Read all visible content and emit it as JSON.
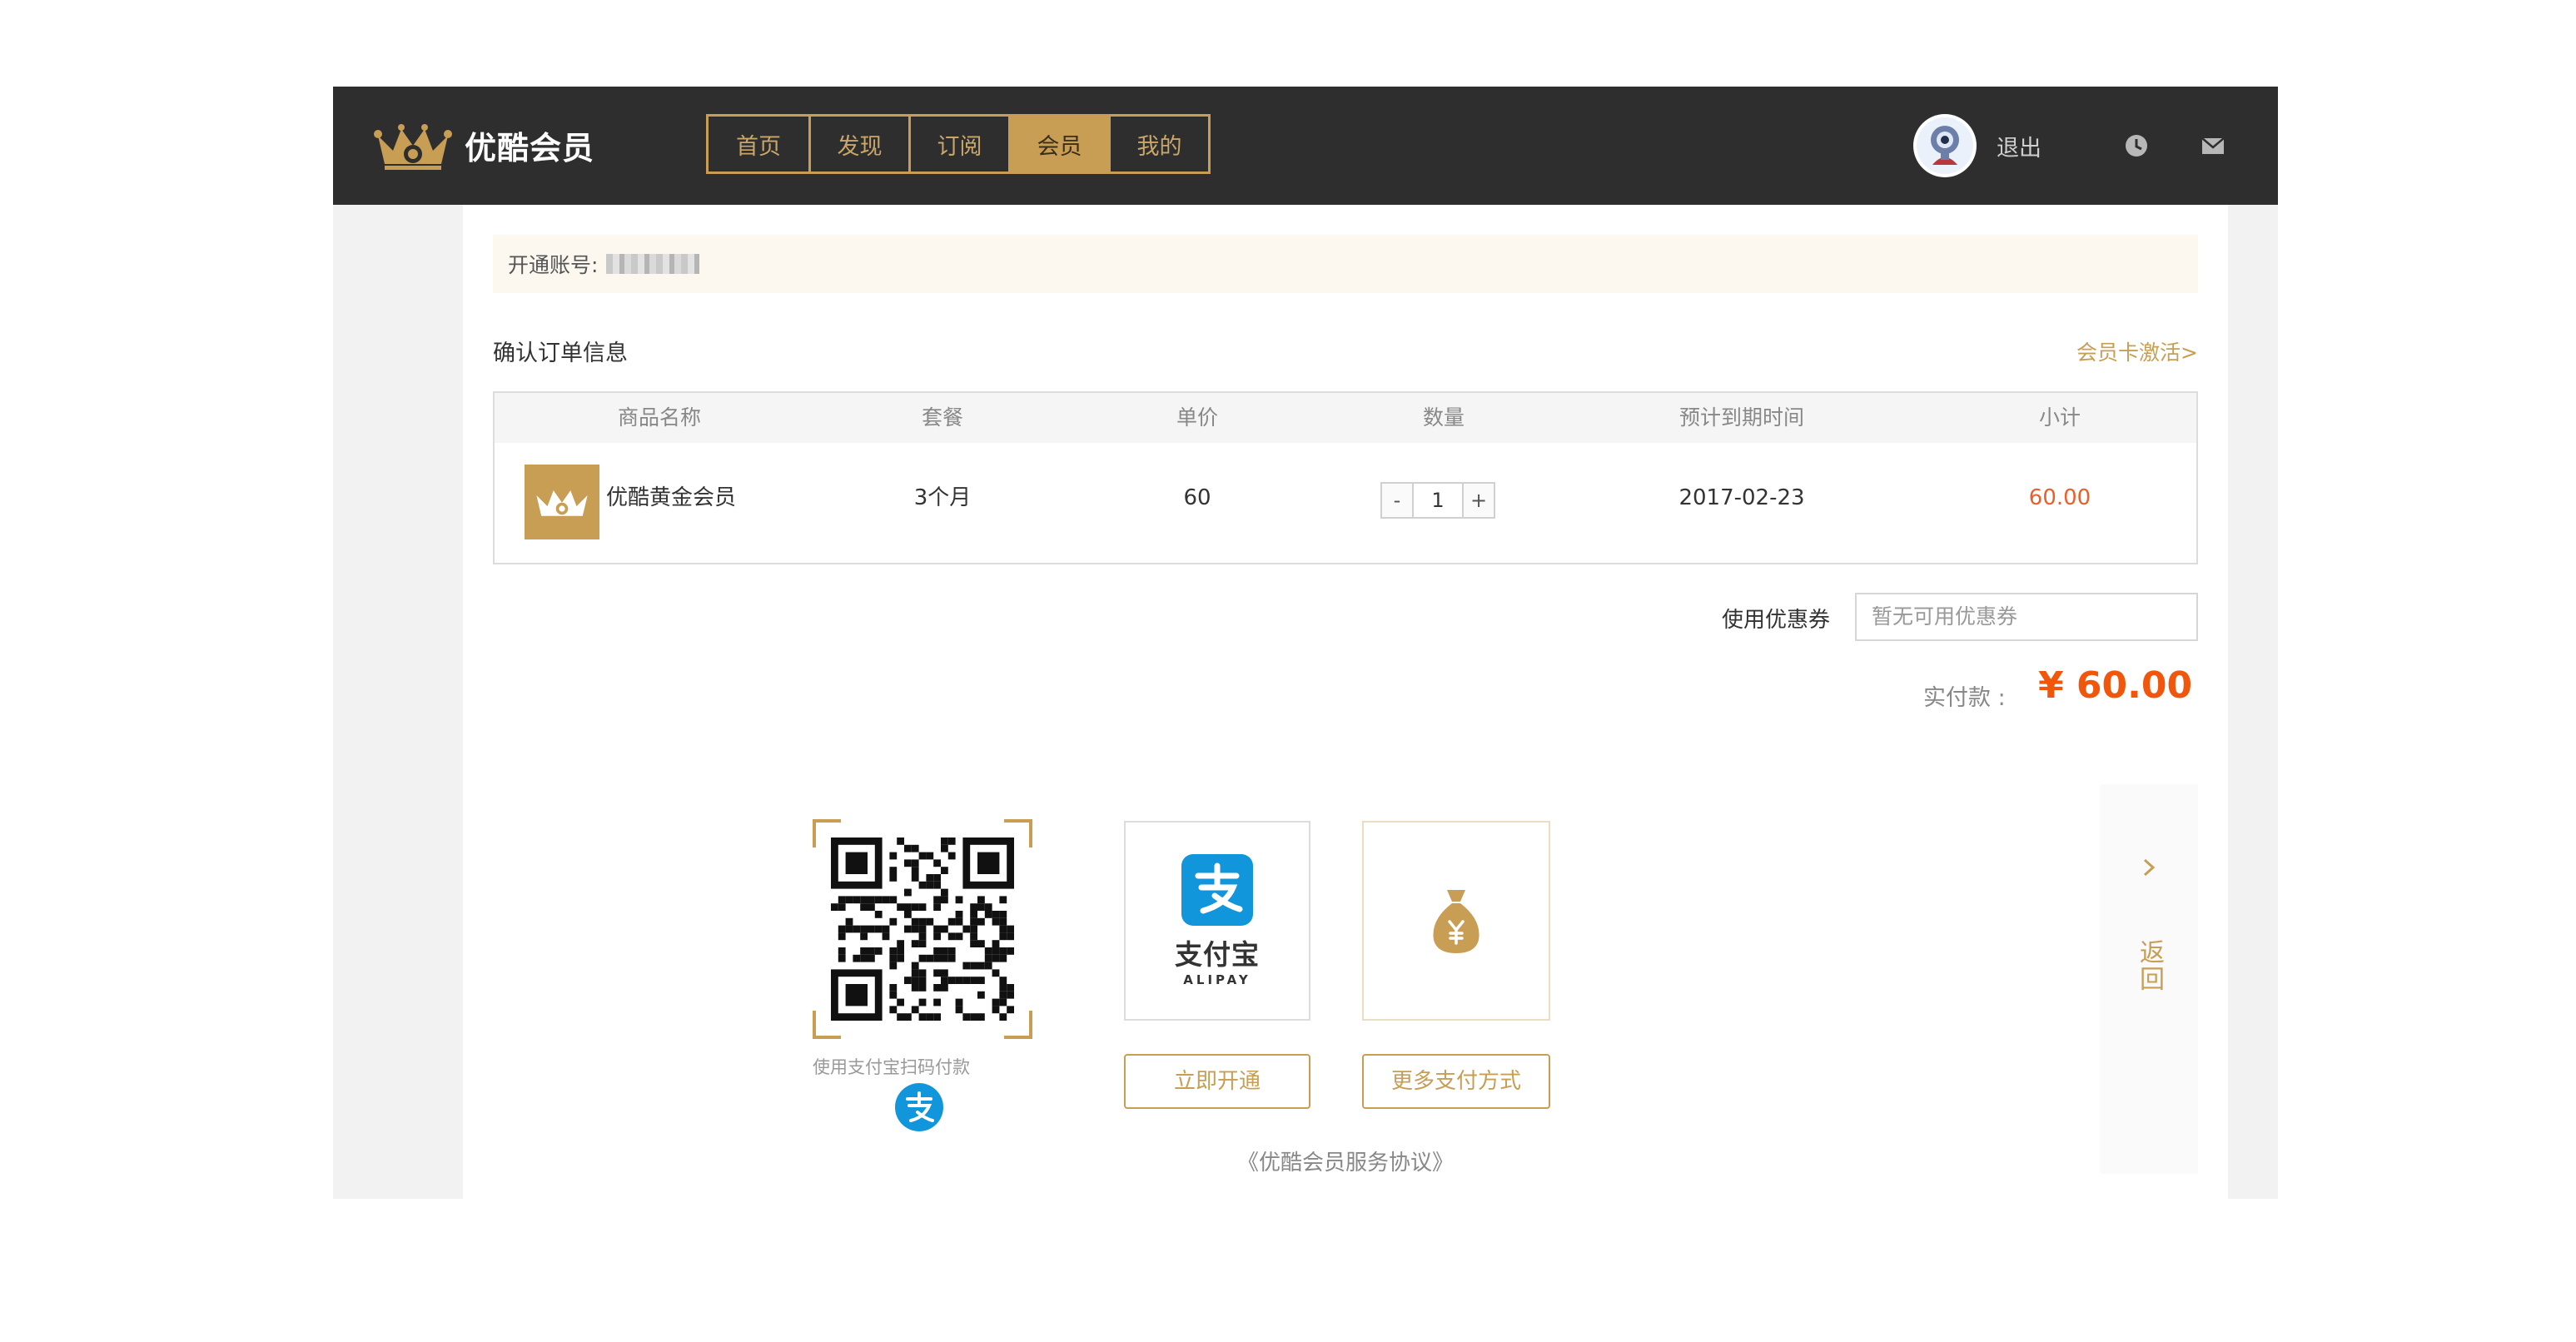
{
  "brand": {
    "name": "优酷会员"
  },
  "nav": {
    "items": [
      {
        "label": "首页",
        "active": false
      },
      {
        "label": "发现",
        "active": false
      },
      {
        "label": "订阅",
        "active": false
      },
      {
        "label": "会员",
        "active": true
      },
      {
        "label": "我的",
        "active": false
      }
    ]
  },
  "user": {
    "logout_label": "退出"
  },
  "account": {
    "label": "开通账号:"
  },
  "order": {
    "section_title": "确认订单信息",
    "activate_link": "会员卡激活>",
    "columns": [
      "商品名称",
      "套餐",
      "单价",
      "数量",
      "预计到期时间",
      "小计"
    ],
    "row": {
      "product": "优酷黄金会员",
      "package": "3个月",
      "unit_price": "60",
      "quantity": "1",
      "expire_date": "2017-02-23",
      "subtotal": "60.00"
    },
    "stepper": {
      "minus": "-",
      "plus": "+"
    }
  },
  "coupon": {
    "label": "使用优惠券",
    "placeholder": "暂无可用优惠券"
  },
  "payment": {
    "amount_label": "实付款 :",
    "amount_value": "¥ 60.00",
    "qr_caption": "使用支付宝扫码付款",
    "alipay_name": "支付宝",
    "alipay_sub": "ALIPAY",
    "open_button": "立即开通",
    "more_button": "更多支付方式",
    "agreement": "《优酷会员服务协议》"
  },
  "side": {
    "back_label": "返回"
  },
  "colors": {
    "topbar": "#2e2e2e",
    "gold": "#c79e53",
    "price_orange": "#f0560c",
    "alipay_blue": "#1296db"
  },
  "icons": [
    "crown-icon",
    "avatar",
    "clock-icon",
    "mail-icon",
    "qr-code",
    "alipay-icon",
    "money-bag-icon",
    "chevron-right-icon"
  ]
}
